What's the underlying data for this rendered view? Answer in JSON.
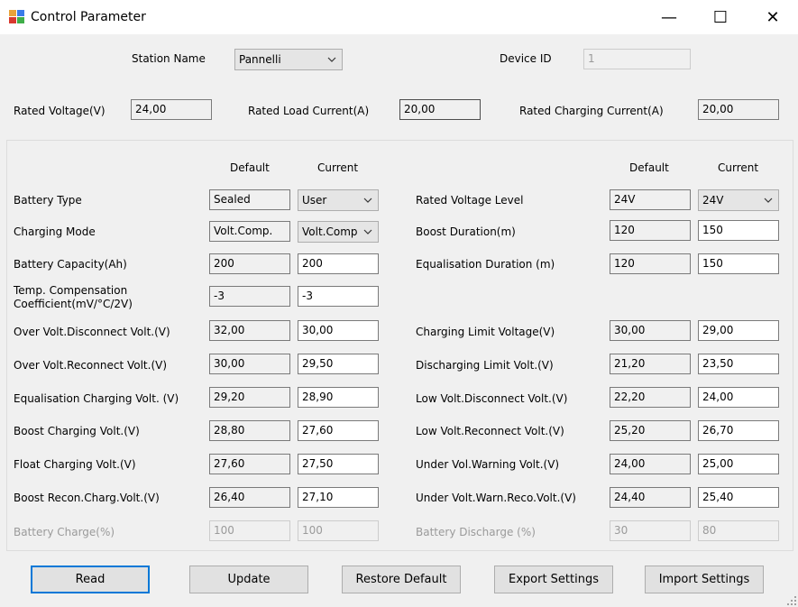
{
  "window": {
    "title": "Control Parameter",
    "controls": {
      "minimize": "—",
      "maximize": "☐",
      "close": "✕"
    }
  },
  "header": {
    "station_name_label": "Station Name",
    "station_name_value": "Pannelli",
    "device_id_label": "Device ID",
    "device_id_value": "1",
    "rated_voltage_label": "Rated Voltage(V)",
    "rated_voltage_value": "24,00",
    "rated_load_current_label": "Rated Load Current(A)",
    "rated_load_current_value": "20,00",
    "rated_charging_current_label": "Rated Charging Current(A)",
    "rated_charging_current_value": "20,00"
  },
  "columns": {
    "default": "Default",
    "current": "Current"
  },
  "left": {
    "battery_type": {
      "label": "Battery Type",
      "default": "Sealed",
      "current": "User"
    },
    "charging_mode": {
      "label": "Charging Mode",
      "default": "Volt.Comp.",
      "current": "Volt.Comp"
    },
    "battery_capacity": {
      "label": "Battery Capacity(Ah)",
      "default": "200",
      "current": "200"
    },
    "temp_compensation": {
      "label_line1": "Temp. Compensation",
      "label_line2": "Coefficient(mV/°C/2V)",
      "default": "-3",
      "current": "-3"
    },
    "over_volt_disconnect": {
      "label": "Over Volt.Disconnect Volt.(V)",
      "default": "32,00",
      "current": "30,00"
    },
    "over_volt_reconnect": {
      "label": "Over Volt.Reconnect Volt.(V)",
      "default": "30,00",
      "current": "29,50"
    },
    "equalisation_charging": {
      "label": "Equalisation Charging Volt. (V)",
      "default": "29,20",
      "current": "28,90"
    },
    "boost_charging": {
      "label": "Boost Charging Volt.(V)",
      "default": "28,80",
      "current": "27,60"
    },
    "float_charging": {
      "label": "Float Charging Volt.(V)",
      "default": "27,60",
      "current": "27,50"
    },
    "boost_recon": {
      "label": "Boost Recon.Charg.Volt.(V)",
      "default": "26,40",
      "current": "27,10"
    },
    "battery_charge": {
      "label": "Battery Charge(%)",
      "default": "100",
      "current": "100"
    }
  },
  "right": {
    "rated_voltage_level": {
      "label": "Rated Voltage Level",
      "default": "24V",
      "current": "24V"
    },
    "boost_duration": {
      "label": "Boost Duration(m)",
      "default": "120",
      "current": "150"
    },
    "equalisation_duration": {
      "label": "Equalisation Duration (m)",
      "default": "120",
      "current": "150"
    },
    "charging_limit": {
      "label": "Charging Limit Voltage(V)",
      "default": "30,00",
      "current": "29,00"
    },
    "discharging_limit": {
      "label": "Discharging Limit Volt.(V)",
      "default": "21,20",
      "current": "23,50"
    },
    "low_volt_disconnect": {
      "label": "Low Volt.Disconnect Volt.(V)",
      "default": "22,20",
      "current": "24,00"
    },
    "low_volt_reconnect": {
      "label": "Low Volt.Reconnect Volt.(V)",
      "default": "25,20",
      "current": "26,70"
    },
    "under_vol_warning": {
      "label": "Under Vol.Warning Volt.(V)",
      "default": "24,00",
      "current": "25,00"
    },
    "under_volt_warn_reco": {
      "label": "Under Volt.Warn.Reco.Volt.(V)",
      "default": "24,40",
      "current": "25,40"
    },
    "battery_discharge": {
      "label": "Battery Discharge (%)",
      "default": "30",
      "current": "80"
    }
  },
  "buttons": {
    "read": "Read",
    "update": "Update",
    "restore_default": "Restore Default",
    "export_settings": "Export Settings",
    "import_settings": "Import Settings"
  },
  "colors": {
    "accent": "#0078d7",
    "window_bg": "#f0f0f0",
    "titlebar_bg": "#ffffff",
    "disabled_text": "#9a9a9a"
  }
}
